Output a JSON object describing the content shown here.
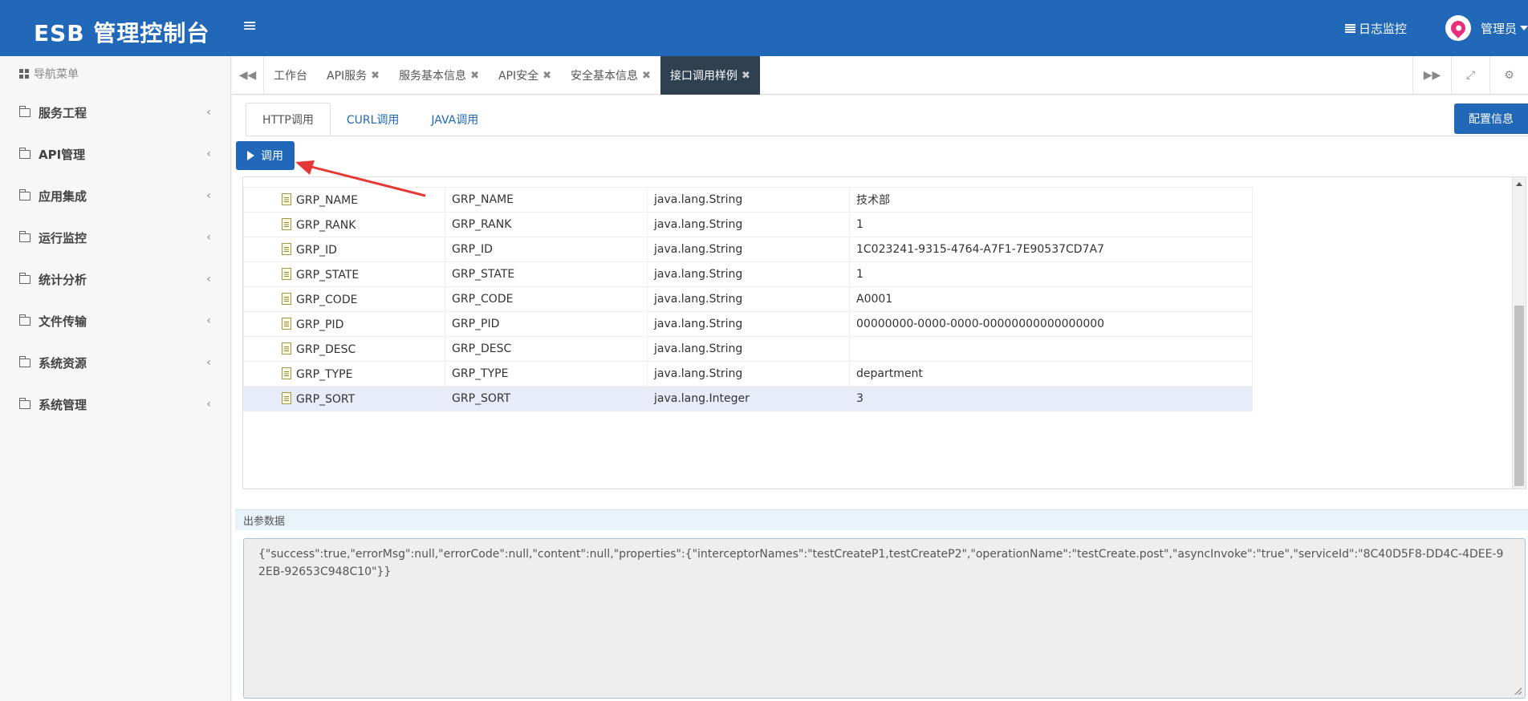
{
  "app": {
    "title": "ESB 管理控制台"
  },
  "header": {
    "log_monitor": "日志监控",
    "user_name": "管理员"
  },
  "sidebar": {
    "title": "导航菜单",
    "items": [
      {
        "label": "服务工程"
      },
      {
        "label": "API管理"
      },
      {
        "label": "应用集成"
      },
      {
        "label": "运行监控"
      },
      {
        "label": "统计分析"
      },
      {
        "label": "文件传输"
      },
      {
        "label": "系统资源"
      },
      {
        "label": "系统管理"
      }
    ]
  },
  "tabs": [
    {
      "label": "工作台"
    },
    {
      "label": "API服务"
    },
    {
      "label": "服务基本信息"
    },
    {
      "label": "API安全"
    },
    {
      "label": "安全基本信息"
    },
    {
      "label": "接口调用样例"
    }
  ],
  "subtabs": [
    "HTTP调用",
    "CURL调用",
    "JAVA调用"
  ],
  "buttons": {
    "config": "配置信息",
    "invoke": "调用"
  },
  "params": [
    {
      "name": "GRP_NAME",
      "alias": "GRP_NAME",
      "type": "java.lang.String",
      "value": "技术部"
    },
    {
      "name": "GRP_RANK",
      "alias": "GRP_RANK",
      "type": "java.lang.String",
      "value": "1"
    },
    {
      "name": "GRP_ID",
      "alias": "GRP_ID",
      "type": "java.lang.String",
      "value": "1C023241-9315-4764-A7F1-7E90537CD7A7"
    },
    {
      "name": "GRP_STATE",
      "alias": "GRP_STATE",
      "type": "java.lang.String",
      "value": "1"
    },
    {
      "name": "GRP_CODE",
      "alias": "GRP_CODE",
      "type": "java.lang.String",
      "value": "A0001"
    },
    {
      "name": "GRP_PID",
      "alias": "GRP_PID",
      "type": "java.lang.String",
      "value": "00000000-0000-0000-00000000000000000"
    },
    {
      "name": "GRP_DESC",
      "alias": "GRP_DESC",
      "type": "java.lang.String",
      "value": ""
    },
    {
      "name": "GRP_TYPE",
      "alias": "GRP_TYPE",
      "type": "java.lang.String",
      "value": "department"
    },
    {
      "name": "GRP_SORT",
      "alias": "GRP_SORT",
      "type": "java.lang.Integer",
      "value": "3"
    }
  ],
  "output": {
    "title": "出参数据",
    "text": "{\"success\":true,\"errorMsg\":null,\"errorCode\":null,\"content\":null,\"properties\":{\"interceptorNames\":\"testCreateP1,testCreateP2\",\"operationName\":\"testCreate.post\",\"asyncInvoke\":\"true\",\"serviceId\":\"8C40D5F8-DD4C-4DEE-92EB-92653C948C10\"}}"
  },
  "colors": {
    "primary": "#2168b8",
    "active_tab": "#2f4050",
    "annotation_arrow": "#e53935"
  }
}
